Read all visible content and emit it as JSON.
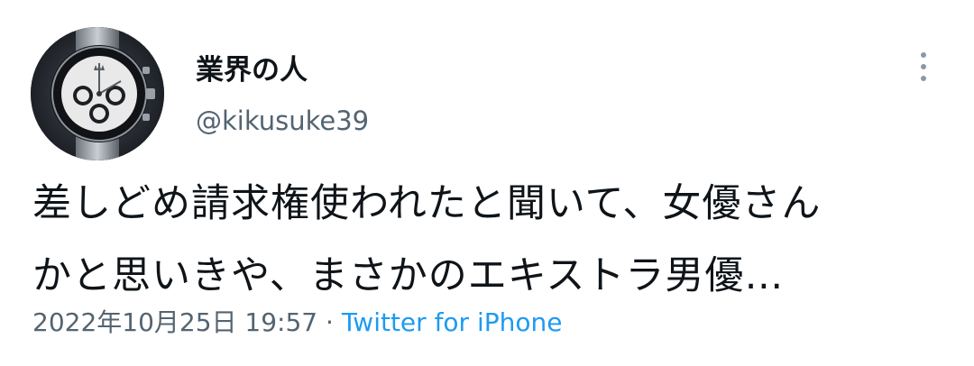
{
  "user": {
    "display_name": "業界の人",
    "handle": "@kikusuke39",
    "avatar_icon": "watch-avatar-icon"
  },
  "tweet": {
    "text_lines": [
      "差しどめ請求権使われたと聞いて、女優さん",
      "かと思いきや、まさかのエキストラ男優…"
    ],
    "timestamp": "2022年10月25日 19:57",
    "separator": "·",
    "source": "Twitter for iPhone"
  },
  "colors": {
    "text": "#0f1419",
    "secondary": "#536471",
    "link": "#1d9bf0"
  }
}
